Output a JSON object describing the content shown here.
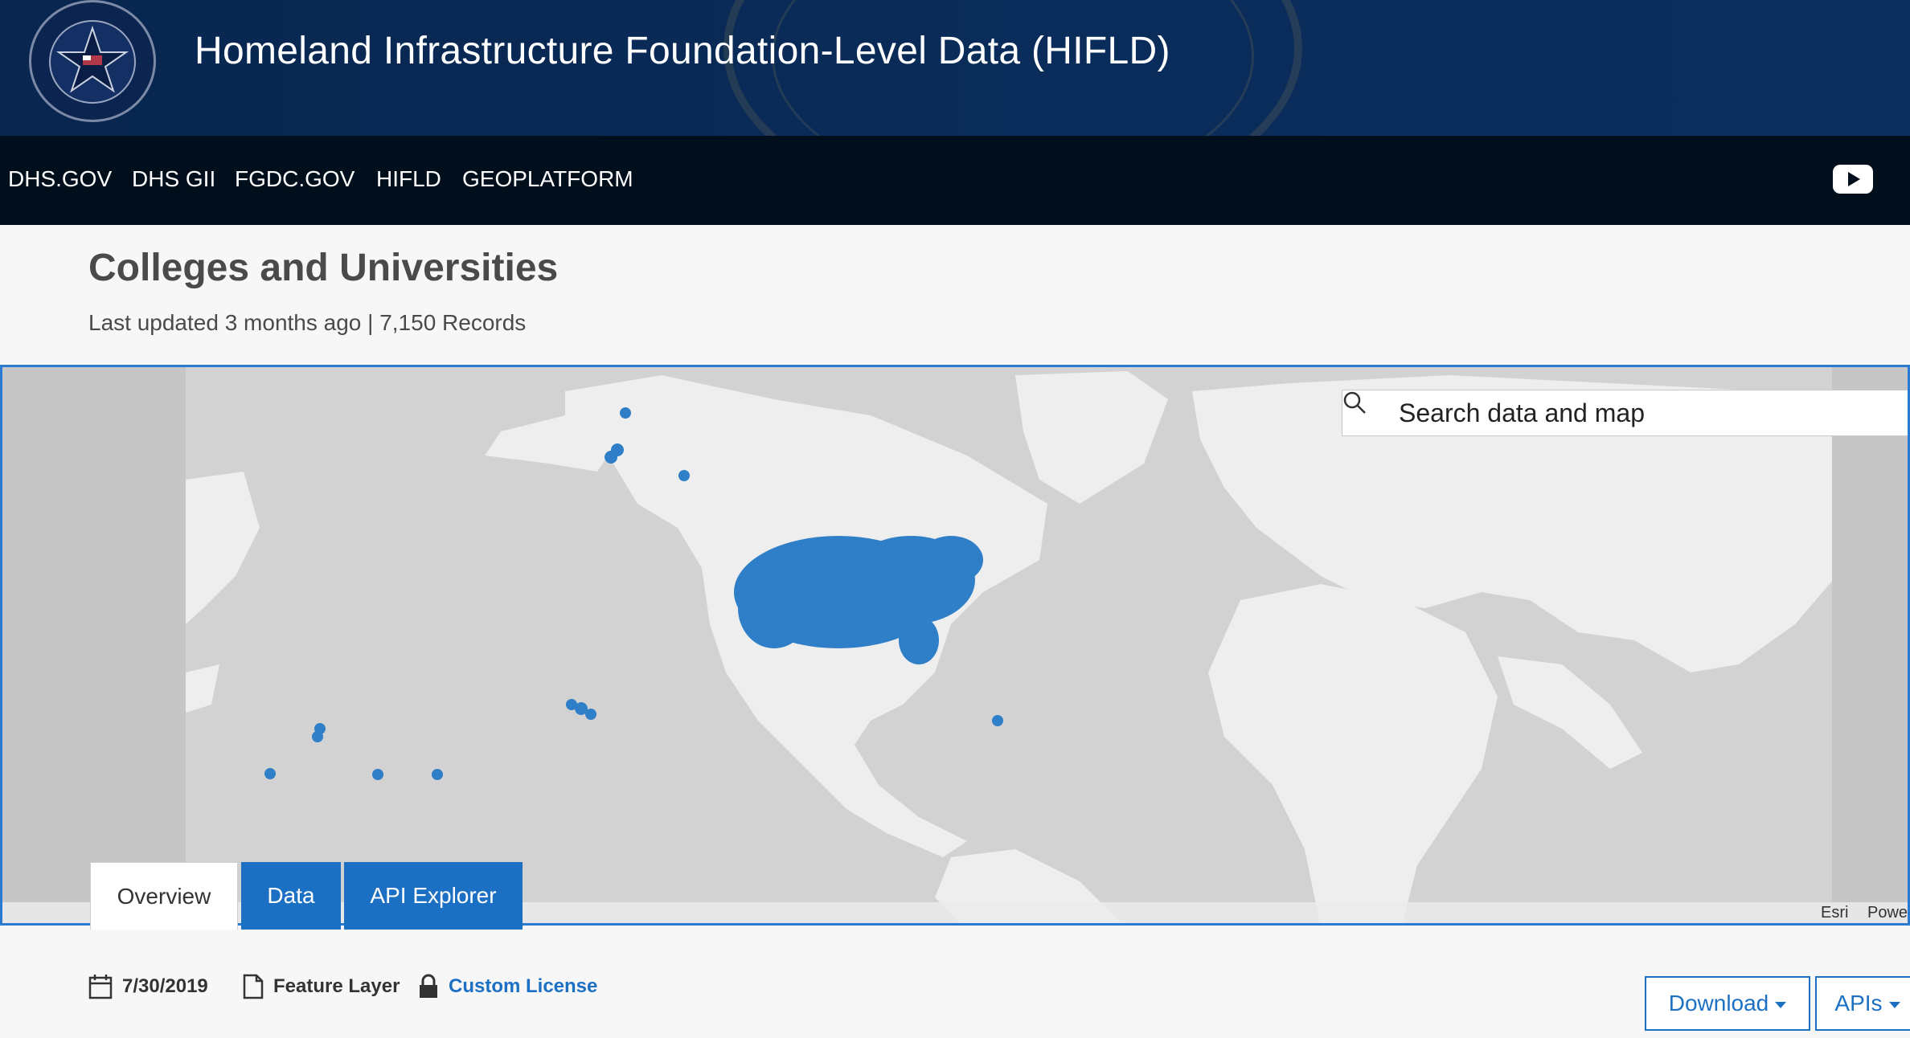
{
  "header": {
    "title": "Homeland Infrastructure Foundation-Level Data (HIFLD)",
    "logo_icon": "hifld-seal-icon"
  },
  "nav": {
    "items": [
      {
        "label": "DHS.GOV"
      },
      {
        "label": "DHS GII"
      },
      {
        "label": "FGDC.GOV"
      },
      {
        "label": "HIFLD"
      },
      {
        "label": "GEOPLATFORM"
      }
    ],
    "youtube_icon": "youtube-icon"
  },
  "dataset": {
    "title": "Colleges and Universities",
    "subtitle": "Last updated 3 months ago | 7,150 Records"
  },
  "map": {
    "search_placeholder": "Search data and map",
    "attribution_esri": "Esri",
    "attribution_powered": "Powe",
    "point_color": "#2f7fc8",
    "land_color": "#eeeeee",
    "water_color": "#d2d2d2"
  },
  "tabs": [
    {
      "label": "Overview",
      "active": true
    },
    {
      "label": "Data",
      "active": false
    },
    {
      "label": "API Explorer",
      "active": false
    }
  ],
  "meta": {
    "date": "7/30/2019",
    "type": "Feature Layer",
    "license": "Custom License"
  },
  "actions": {
    "download": "Download",
    "apis": "APIs"
  },
  "colors": {
    "accent": "#1c70c4",
    "header_bg": "#0a2c5a",
    "nav_bg": "#010f1c"
  }
}
